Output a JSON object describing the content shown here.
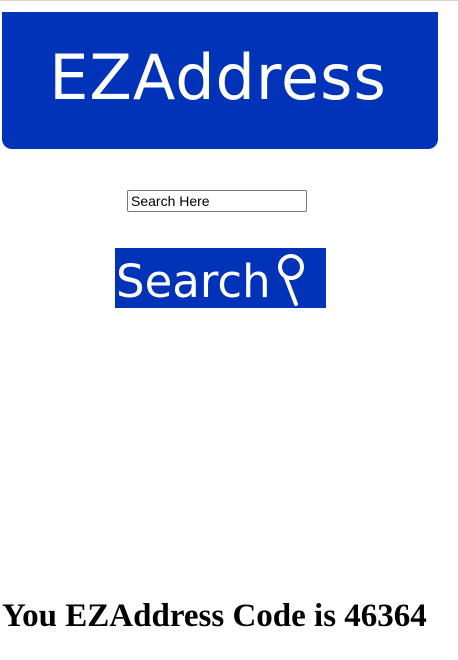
{
  "colors": {
    "brand": "#0033b7",
    "text": "#000000",
    "background": "#ffffff"
  },
  "banner": {
    "title": "EZAddress"
  },
  "search": {
    "value": "Search Here",
    "button_label": "Search",
    "button_icon": "magnifier-icon"
  },
  "result": {
    "text": "You EZAddress Code is 46364"
  }
}
